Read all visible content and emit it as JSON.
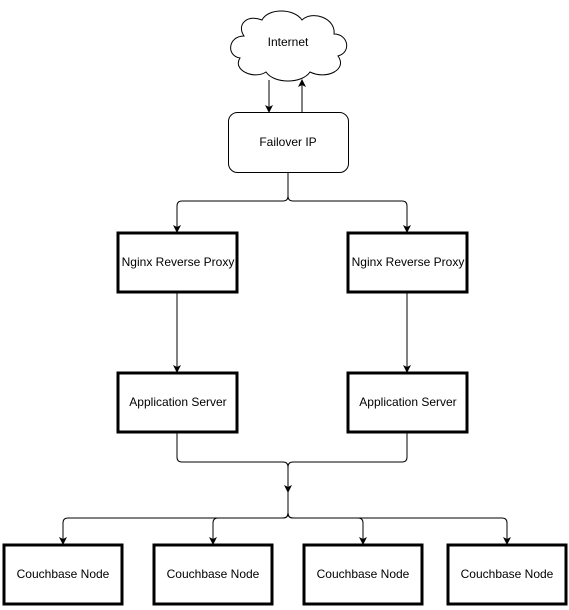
{
  "nodes": {
    "internet": "Internet",
    "failover": "Failover IP",
    "nginx_left": "Nginx Reverse Proxy",
    "nginx_right": "Nginx Reverse Proxy",
    "app_left": "Application Server",
    "app_right": "Application Server",
    "couch": [
      "Couchbase Node",
      "Couchbase Node",
      "Couchbase Node",
      "Couchbase Node"
    ]
  },
  "edges": [
    {
      "from": "internet",
      "to": "failover"
    },
    {
      "from": "failover",
      "to": "internet"
    },
    {
      "from": "failover",
      "to": "nginx_left"
    },
    {
      "from": "failover",
      "to": "nginx_right"
    },
    {
      "from": "nginx_left",
      "to": "app_left"
    },
    {
      "from": "nginx_right",
      "to": "app_right"
    },
    {
      "from": "app_left",
      "to": "couch"
    },
    {
      "from": "app_right",
      "to": "couch"
    }
  ]
}
